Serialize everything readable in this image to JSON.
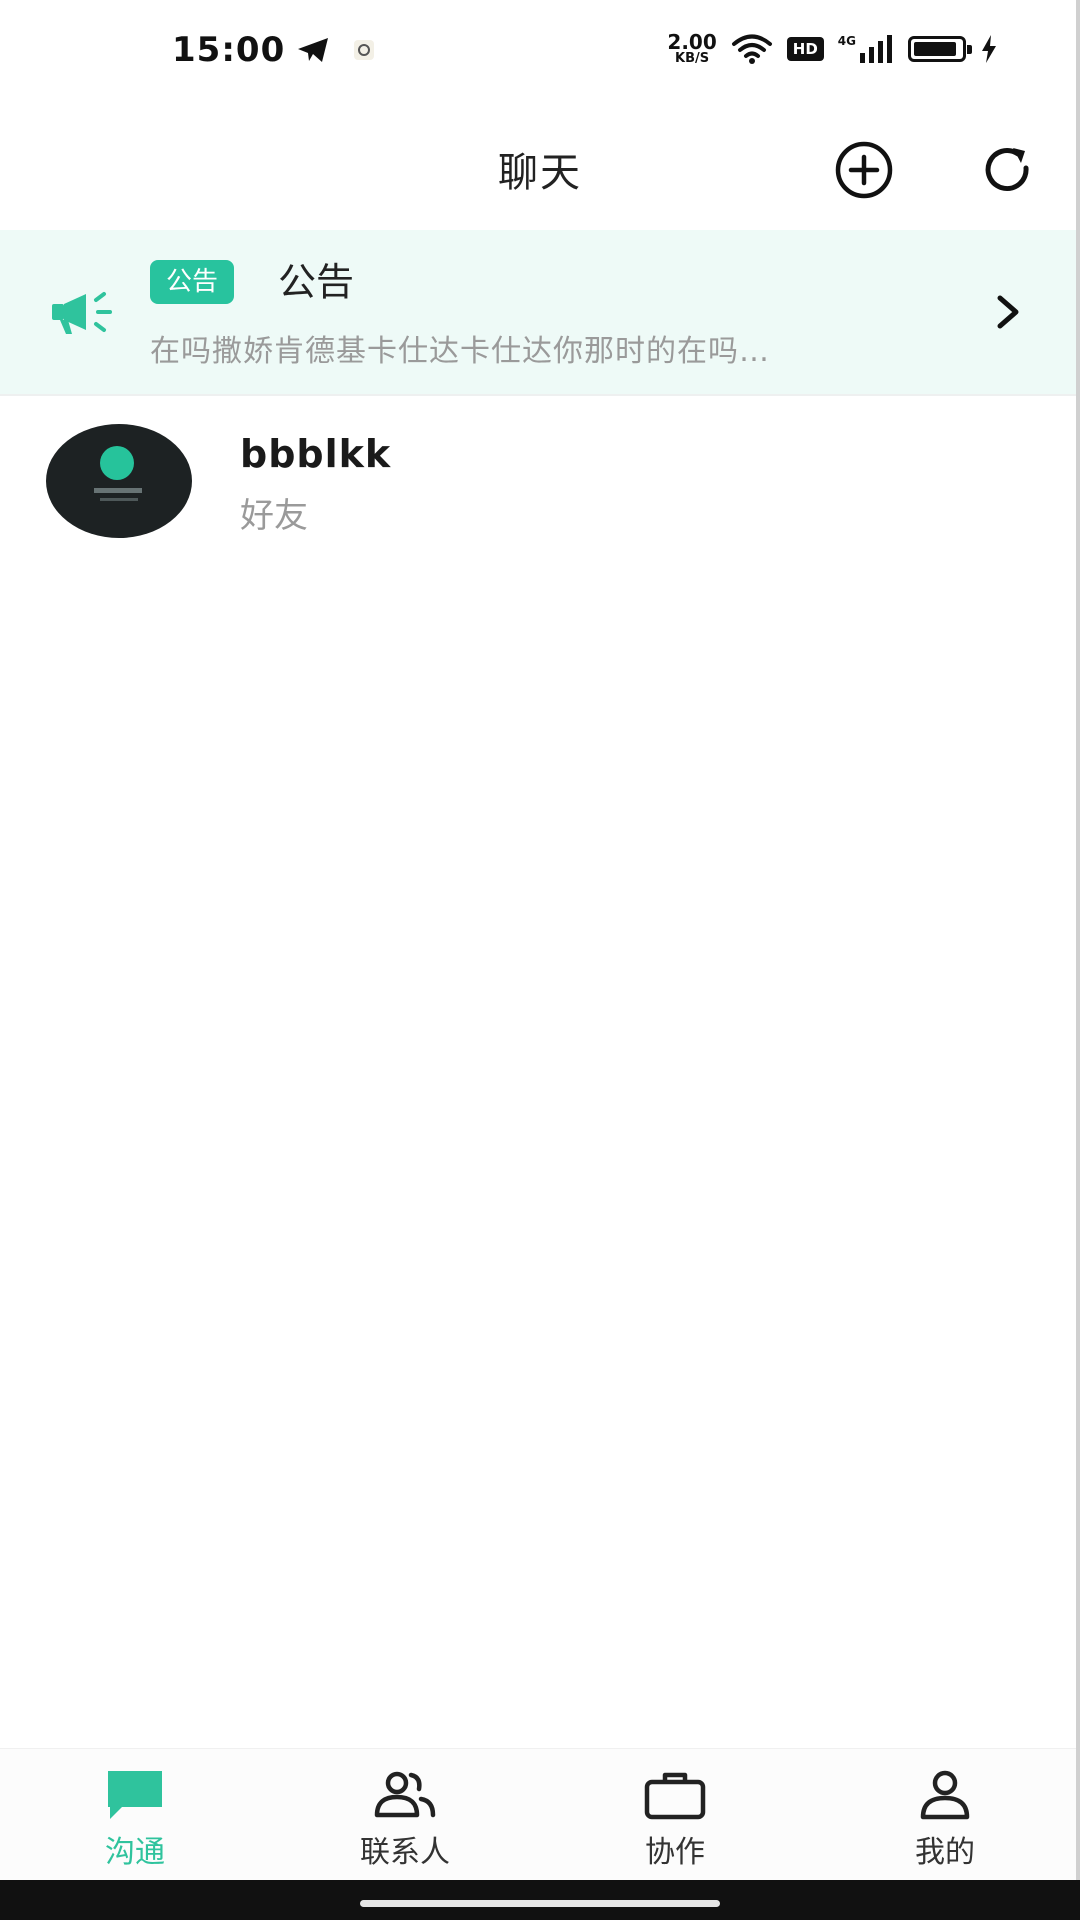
{
  "status_bar": {
    "time": "15:00",
    "net_speed_value": "2.00",
    "net_speed_unit": "KB/S",
    "hd_label": "HD",
    "signal_label": "4G",
    "battery_level": 0.92
  },
  "header": {
    "title": "聊天"
  },
  "announcement": {
    "badge": "公告",
    "title": "公告",
    "text": "在吗撒娇肯德基卡仕达卡仕达你那时的在吗…"
  },
  "chats": [
    {
      "name": "bbblkk",
      "subtitle": "好友"
    }
  ],
  "bottom_nav": {
    "items": [
      {
        "label": "沟通",
        "active": true
      },
      {
        "label": "联系人",
        "active": false
      },
      {
        "label": "协作",
        "active": false
      },
      {
        "label": "我的",
        "active": false
      }
    ]
  },
  "colors": {
    "accent": "#2fc39d",
    "announcement_bg": "#eefaf7"
  }
}
